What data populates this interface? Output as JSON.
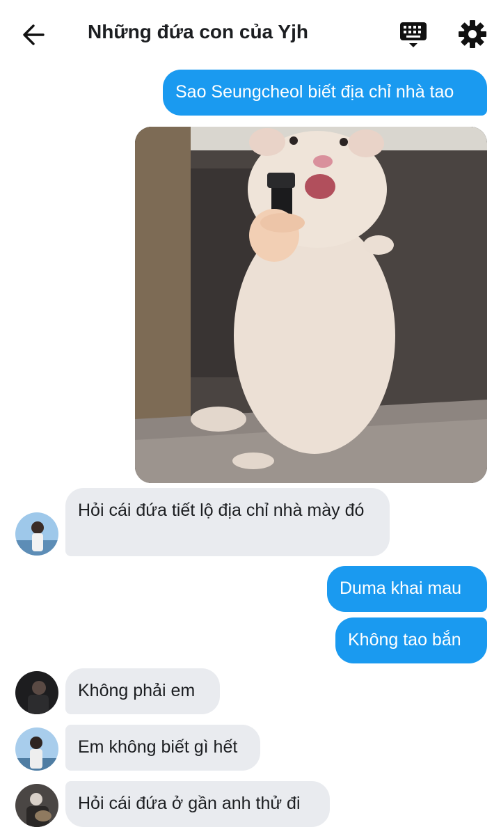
{
  "header": {
    "title": "Những đứa con của Yjh",
    "back_icon": "arrow-left-icon",
    "keyboard_icon": "keyboard-icon",
    "settings_icon": "gear-icon"
  },
  "messages": [
    {
      "from": "me",
      "text": "Sao Seungcheol biết địa chỉ nhà tao"
    },
    {
      "from": "me",
      "type": "image",
      "image": "hamster-holding-gun-meme"
    },
    {
      "from": "other",
      "text": "Hỏi cái đứa tiết lộ địa chỉ nhà mày đó"
    },
    {
      "from": "me",
      "text": "Duma khai mau"
    },
    {
      "from": "me",
      "text": "Không tao bắn"
    },
    {
      "from": "other",
      "text": "Không phải em"
    },
    {
      "from": "other",
      "text": "Em không biết gì hết"
    },
    {
      "from": "other",
      "text": "Hỏi cái đứa ở gần anh thử đi"
    }
  ],
  "colors": {
    "outgoing_bubble": "#1a9af0",
    "incoming_bubble": "#e9ebef",
    "text_dark": "#1c1e21"
  }
}
